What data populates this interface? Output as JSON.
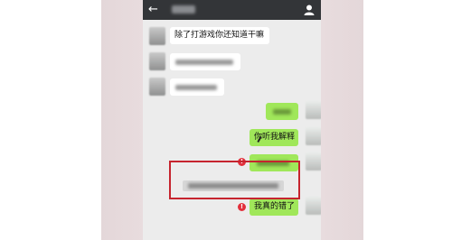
{
  "titlebar": {
    "back_icon": "arrow-left-icon",
    "contact_icon": "person-icon"
  },
  "messages": {
    "incoming_1": "除了打游戏你还知道干嘛",
    "outgoing_2": "你听我解释",
    "outgoing_4": "我真的错了"
  },
  "status_icons": {
    "failed": "!"
  },
  "colors": {
    "titlebar": "#333538",
    "chat_background": "#ececec",
    "outgoing_bubble": "#a0e75a",
    "incoming_bubble": "#ffffff",
    "highlight_box": "#c6242e",
    "failed_icon": "#e2303c"
  }
}
